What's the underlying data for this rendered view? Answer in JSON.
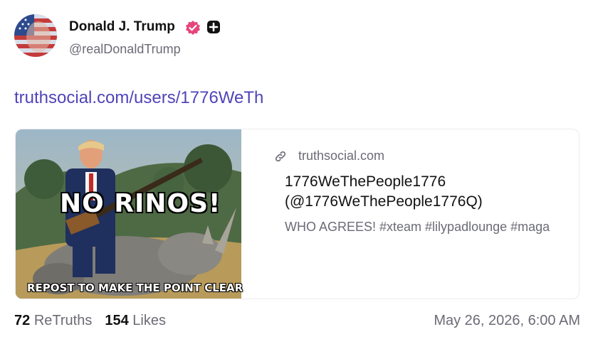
{
  "post": {
    "author_name": "Donald J. Trump",
    "handle": "@realDonaldTrump",
    "link_text": "truthsocial.com/users/1776WeTh",
    "verified_color": "#e5457a"
  },
  "card": {
    "domain": "truthsocial.com",
    "title": "1776WeThePeople1776 (@1776WeThePeople1776Q)",
    "description": "WHO AGREES! #xteam #lilypadlounge #maga",
    "image_headline": "NO RINOS!",
    "image_caption": "REPOST TO MAKE THE POINT CLEAR"
  },
  "stats": {
    "retruths_count": "72",
    "retruths_label": "ReTruths",
    "likes_count": "154",
    "likes_label": "Likes"
  },
  "timestamp": "May 26, 2026, 6:00 AM"
}
